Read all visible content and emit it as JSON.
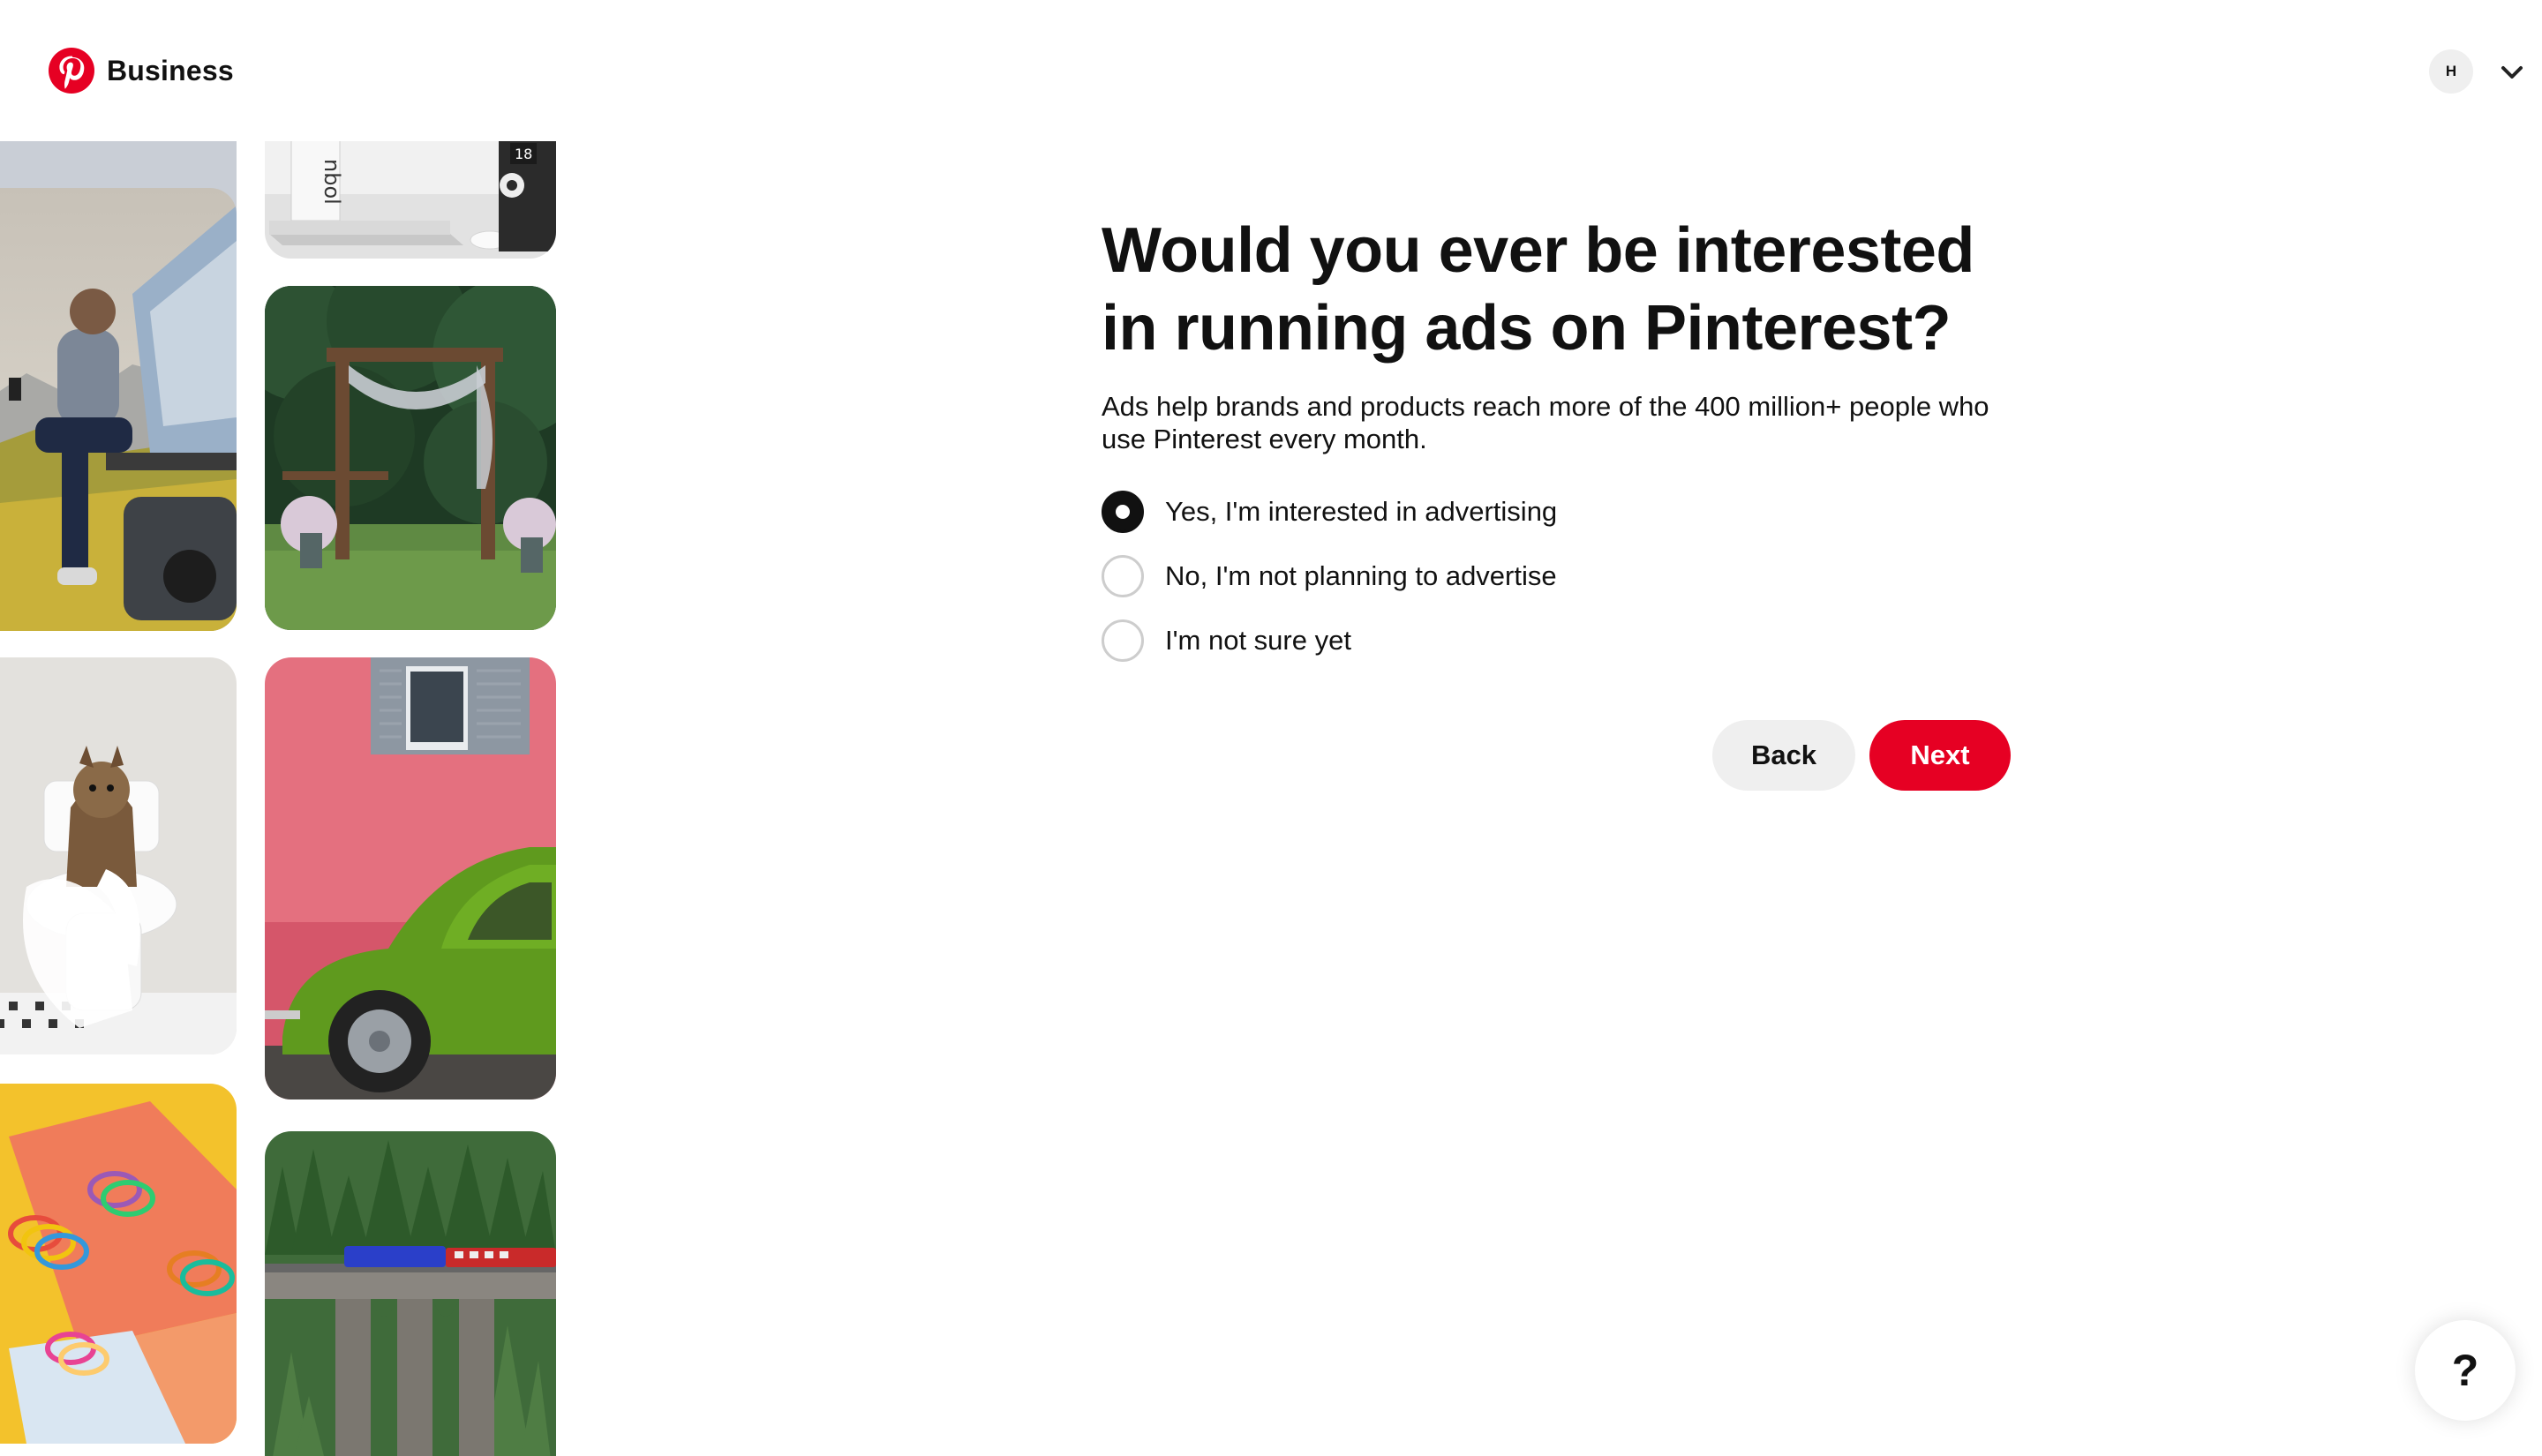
{
  "header": {
    "brand": "Business",
    "avatar_initial": "H",
    "logo_icon": "pinterest-logo",
    "menu_icon": "chevron-down-icon"
  },
  "grid": {
    "tiles": [
      {
        "subject": "camper-van-partial"
      },
      {
        "subject": "laptop-desk"
      },
      {
        "subject": "man-on-car-tent-mountains"
      },
      {
        "subject": "wedding-arch-garden"
      },
      {
        "subject": "dog-on-toilet"
      },
      {
        "subject": "green-beetle-pink-wall"
      },
      {
        "subject": "slinky-toys-yellow"
      },
      {
        "subject": "train-on-viaduct-forest"
      }
    ],
    "laptop_badge": "18"
  },
  "main": {
    "title": "Would you ever be interested in running ads on Pinterest?",
    "subtitle": "Ads help brands and products reach more of the 400 million+ people who use Pinterest every month.",
    "options": [
      {
        "label": "Yes, I'm interested in advertising",
        "selected": true
      },
      {
        "label": "No, I'm not planning to advertise",
        "selected": false
      },
      {
        "label": "I'm not sure yet",
        "selected": false
      }
    ],
    "back_label": "Back",
    "next_label": "Next"
  },
  "help": {
    "label": "?"
  },
  "colors": {
    "brand_red": "#e60023",
    "text": "#111111",
    "secondary_button": "#efefef"
  }
}
